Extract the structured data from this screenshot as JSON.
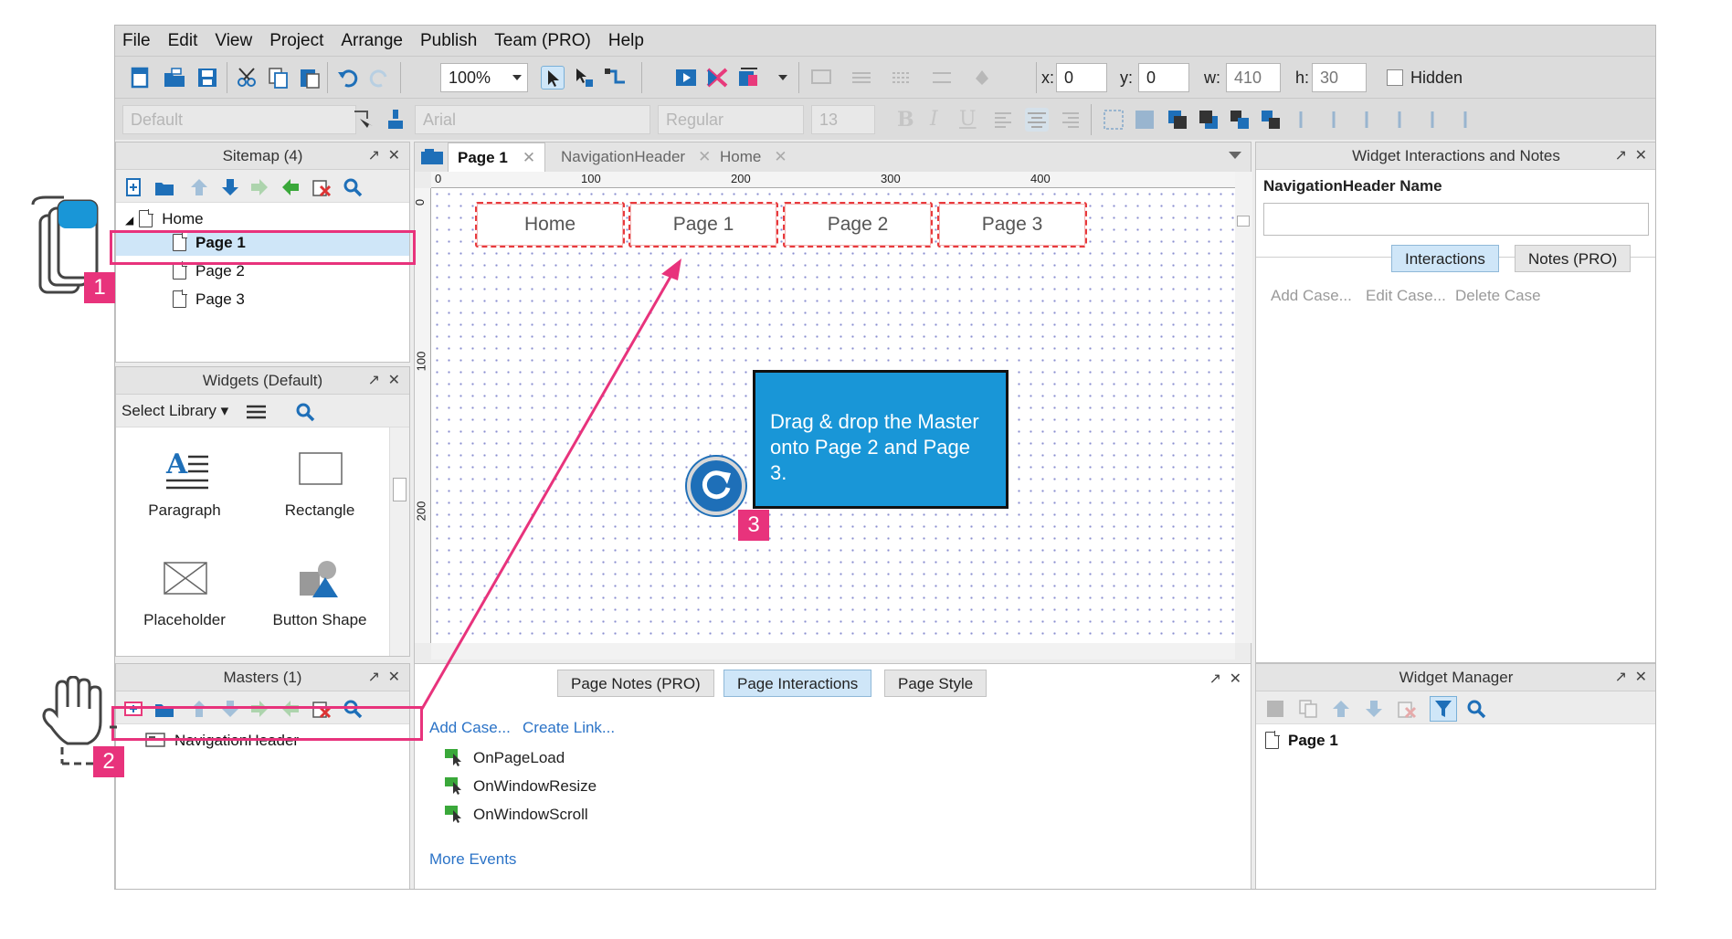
{
  "menu": [
    "File",
    "Edit",
    "View",
    "Project",
    "Arrange",
    "Publish",
    "Team (PRO)",
    "Help"
  ],
  "toolbar": {
    "zoom": "100%",
    "x_label": "x:",
    "x_value": "0",
    "y_label": "y:",
    "y_value": "0",
    "w_label": "w:",
    "w_value": "410",
    "h_label": "h:",
    "h_value": "30",
    "hidden_label": "Hidden",
    "style_default": "Default",
    "font": "Arial",
    "weight": "Regular",
    "size": "13",
    "bold": "B",
    "italic": "I",
    "underline": "U"
  },
  "sitemap": {
    "title": "Sitemap (4)",
    "pages": [
      "Home",
      "Page 1",
      "Page 2",
      "Page 3"
    ],
    "selected": "Page 1"
  },
  "widgets": {
    "title": "Widgets (Default)",
    "select_library": "Select Library",
    "items": [
      "Paragraph",
      "Rectangle",
      "Placeholder",
      "Button Shape"
    ]
  },
  "masters": {
    "title": "Masters (1)",
    "items": [
      "NavigationHeader"
    ]
  },
  "canvas": {
    "tabs": [
      "Page 1",
      "NavigationHeader",
      "Home"
    ],
    "ruler_top": [
      "0",
      "100",
      "200",
      "300",
      "400"
    ],
    "ruler_left": [
      "0",
      "100",
      "200"
    ],
    "nav_buttons": [
      "Home",
      "Page 1",
      "Page 2",
      "Page 3"
    ],
    "callout": "Drag & drop the Master onto Page 2 and Page 3."
  },
  "page_props": {
    "tabs": [
      "Page Notes (PRO)",
      "Page Interactions",
      "Page Style"
    ],
    "active_tab": "Page Interactions",
    "add_case": "Add Case...",
    "create_link": "Create Link...",
    "events": [
      "OnPageLoad",
      "OnWindowResize",
      "OnWindowScroll"
    ],
    "more_events": "More Events"
  },
  "interactions_panel": {
    "title": "Widget Interactions and Notes",
    "name_label": "NavigationHeader Name",
    "name_value": "",
    "tabs": [
      "Interactions",
      "Notes (PRO)"
    ],
    "actions": [
      "Add Case...",
      "Edit Case...",
      "Delete Case"
    ]
  },
  "widget_manager": {
    "title": "Widget Manager",
    "items": [
      "Page 1"
    ]
  },
  "annotations": {
    "step1": "1",
    "step2": "2",
    "step3": "3"
  },
  "colors": {
    "accent": "#e8337c",
    "callout": "#1996d7",
    "selection": "#cfe6f8",
    "link": "#2b73c7",
    "nav_border": "#e8393c"
  },
  "icons": [
    "new-page-icon",
    "folder-icon",
    "save-icon",
    "cut-icon",
    "copy-icon",
    "paste-icon",
    "undo-icon",
    "redo-icon",
    "select-icon",
    "connector-icon",
    "preview-icon",
    "share-icon",
    "publish-icon",
    "search-icon",
    "filter-icon",
    "hand-drag-icon",
    "stacked-pages-icon",
    "refresh-icon"
  ]
}
